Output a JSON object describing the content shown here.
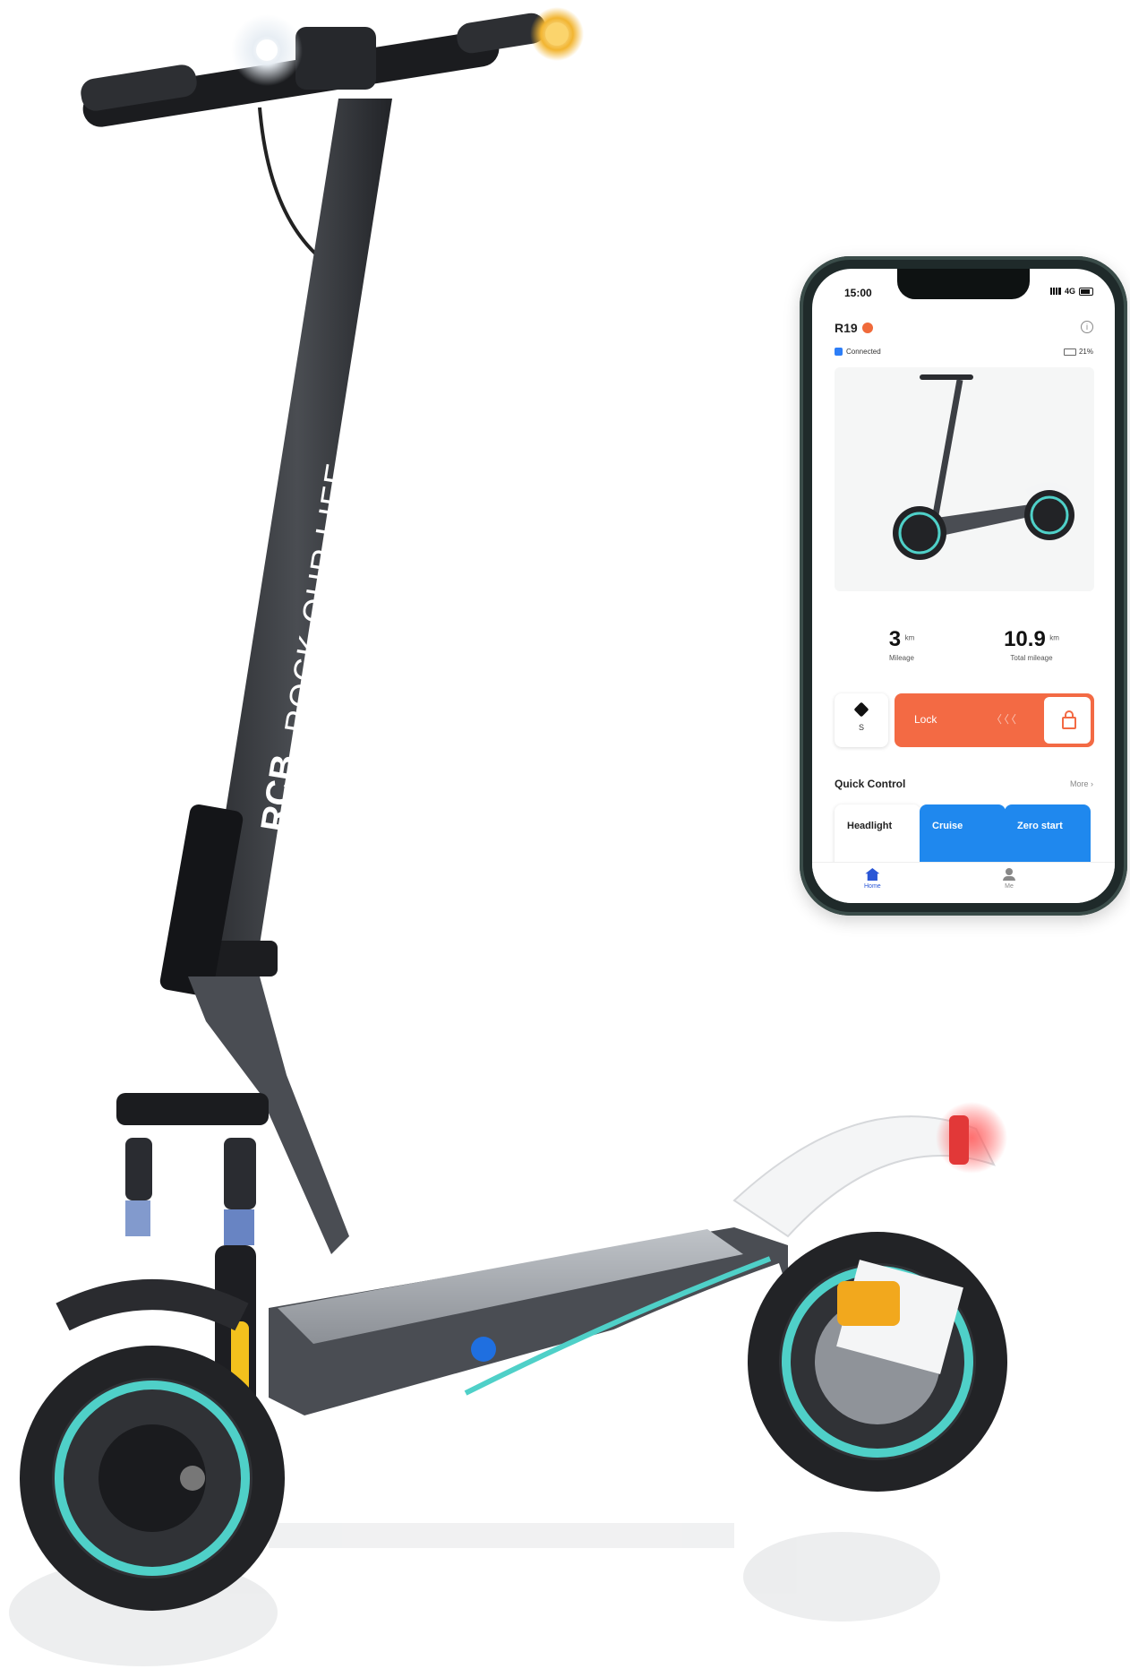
{
  "brand_text": "ROCK OUR LIFE",
  "deck_logo": "RCB",
  "phone": {
    "status_time": "15:00",
    "network": "4G",
    "model_name": "R19",
    "connection_status": "Connected",
    "battery_percent": "21%",
    "mileage_value": "3",
    "mileage_unit": "km",
    "mileage_label": "Mileage",
    "total_mileage_value": "10.9",
    "total_mileage_unit": "km",
    "total_mileage_label": "Total mileage",
    "gear_value": "S",
    "lock_label": "Lock",
    "lock_hint": "〈〈〈",
    "quick_control_title": "Quick Control",
    "more_label": "More ›",
    "tiles": [
      "Headlight",
      "Cruise",
      "Zero start"
    ],
    "tab_home": "Home",
    "tab_me": "Me"
  },
  "colors": {
    "accent_orange": "#f36a44",
    "tile_blue": "#1f88ee",
    "scooter_teal": "#4fd0c8",
    "frame_grey": "#3c3f44"
  }
}
